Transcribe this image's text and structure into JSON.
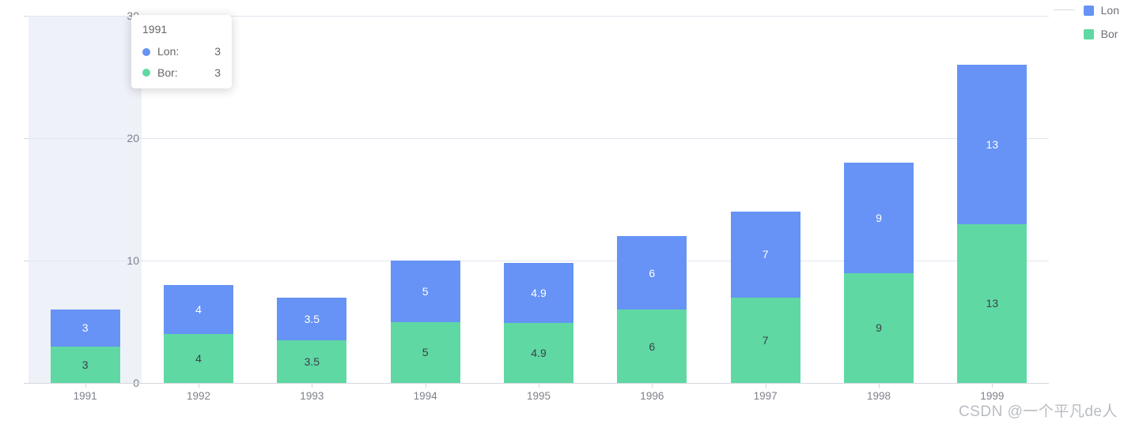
{
  "chart_data": {
    "type": "bar",
    "stacked": true,
    "title": "",
    "xlabel": "",
    "ylabel": "",
    "categories": [
      "1991",
      "1992",
      "1993",
      "1994",
      "1995",
      "1996",
      "1997",
      "1998",
      "1999"
    ],
    "series": [
      {
        "name": "Bor",
        "color": "#5fd8a4",
        "values": [
          3,
          4,
          3.5,
          5,
          4.9,
          6,
          7,
          9,
          13
        ]
      },
      {
        "name": "Lon",
        "color": "#6693f5",
        "values": [
          3,
          4,
          3.5,
          5,
          4.9,
          6,
          7,
          9,
          13
        ]
      }
    ],
    "totals": [
      6,
      8,
      7,
      10,
      9.8,
      12,
      14,
      18,
      26
    ],
    "ylim": [
      0,
      30
    ],
    "y_ticks": [
      "0",
      "10",
      "20",
      "30"
    ],
    "y_tick_values": [
      0,
      10,
      20,
      30
    ],
    "grid": true,
    "legend_position": "top-right",
    "highlighted_category": "1991"
  },
  "legend": {
    "items": [
      {
        "label": "Lon",
        "color": "#6693f5"
      },
      {
        "label": "Bor",
        "color": "#5fd8a4"
      }
    ]
  },
  "tooltip": {
    "title": "1991",
    "rows": [
      {
        "name": "Lon:",
        "value": "3",
        "color": "#6693f5"
      },
      {
        "name": "Bor:",
        "value": "3",
        "color": "#5fd8a4"
      }
    ]
  },
  "watermark": {
    "text": "CSDN @一个平凡de人"
  },
  "colors": {
    "series_blue": "#6693f5",
    "series_green": "#5fd8a4",
    "gridline": "#e0e6f1",
    "axis": "#d4d7de",
    "highlight_band": "#eef1f8",
    "label_light": "#ffffff",
    "label_dark": "#3b4049"
  }
}
